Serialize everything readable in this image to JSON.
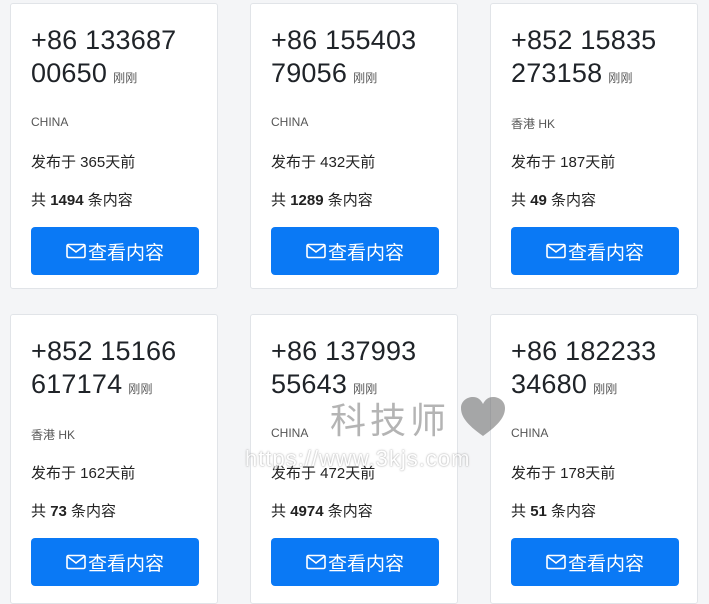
{
  "colors": {
    "accent": "#0a79f5",
    "card_bg": "#ffffff",
    "page_bg": "#f4f5f7"
  },
  "cards": [
    {
      "phone_line1": "+86 133687",
      "phone_line2": "00650",
      "tag": "刚刚",
      "country": "CHINA",
      "posted": "发布于 365天前",
      "count_prefix": "共",
      "count": "1494",
      "count_suffix": "条内容",
      "button": "查看内容"
    },
    {
      "phone_line1": "+86 155403",
      "phone_line2": "79056",
      "tag": "刚刚",
      "country": "CHINA",
      "posted": "发布于 432天前",
      "count_prefix": "共",
      "count": "1289",
      "count_suffix": "条内容",
      "button": "查看内容"
    },
    {
      "phone_line1": "+852 15835",
      "phone_line2": "273158",
      "tag": "刚刚",
      "country": "香港 HK",
      "posted": "发布于 187天前",
      "count_prefix": "共",
      "count": "49",
      "count_suffix": "条内容",
      "button": "查看内容"
    },
    {
      "phone_line1": "+852 15166",
      "phone_line2": "617174",
      "tag": "刚刚",
      "country": "香港 HK",
      "posted": "发布于 162天前",
      "count_prefix": "共",
      "count": "73",
      "count_suffix": "条内容",
      "button": "查看内容"
    },
    {
      "phone_line1": "+86 137993",
      "phone_line2": "55643",
      "tag": "刚刚",
      "country": "CHINA",
      "posted": "发布于 472天前",
      "count_prefix": "共",
      "count": "4974",
      "count_suffix": "条内容",
      "button": "查看内容"
    },
    {
      "phone_line1": "+86 182233",
      "phone_line2": "34680",
      "tag": "刚刚",
      "country": "CHINA",
      "posted": "发布于 178天前",
      "count_prefix": "共",
      "count": "51",
      "count_suffix": "条内容",
      "button": "查看内容"
    }
  ],
  "watermark": {
    "title": "科技师",
    "url": "https://www.3kjs.com",
    "icon": "heart-icon"
  }
}
